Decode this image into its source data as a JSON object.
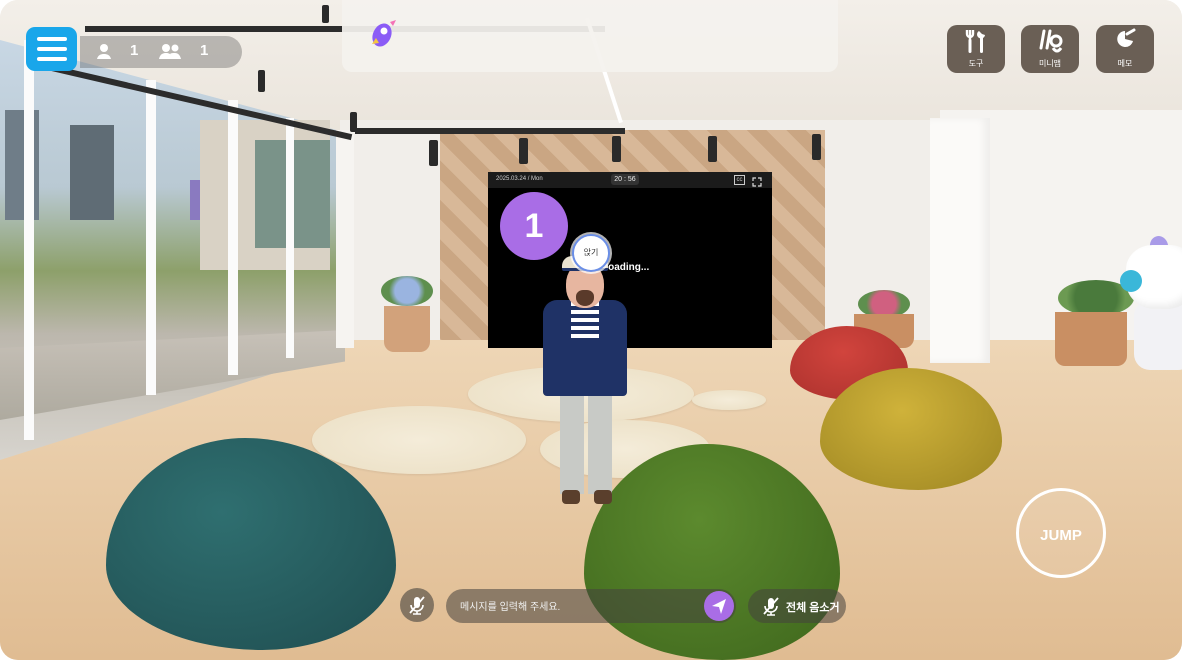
{
  "header": {
    "menu_icon": "hamburger-menu-icon",
    "visitor_count": "1",
    "user_count": "1",
    "logo_icon": "rocket-logo-icon"
  },
  "tools": [
    {
      "label": "도구",
      "icon": "tools-icon"
    },
    {
      "label": "미니맵",
      "icon": "minimap-icon"
    },
    {
      "label": "메모",
      "icon": "memo-icon"
    }
  ],
  "screen": {
    "date": "2025.03.24 / Mon",
    "clock": "20 : 56",
    "loading_text": "Loading...",
    "cc_icon": "cc-icon",
    "fullscreen_icon": "fullscreen-icon"
  },
  "marker": {
    "number": "1"
  },
  "avatar": {
    "sit_label": "앉기"
  },
  "jump": {
    "label": "JUMP"
  },
  "chat": {
    "placeholder": "메시지를 입력해 주세요.",
    "mic_icon": "mic-off-icon",
    "send_icon": "send-icon",
    "mute_all_label": "전체 음소거"
  },
  "colors": {
    "menu_blue": "#19a6ea",
    "accent_purple": "#a96de6",
    "tool_brown": "#6a5f55"
  }
}
